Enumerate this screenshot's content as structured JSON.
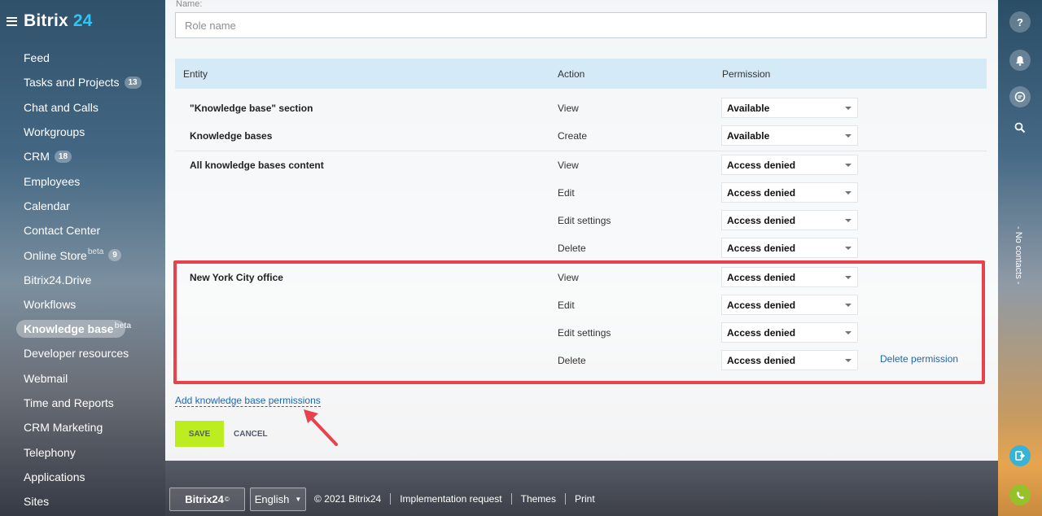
{
  "app": {
    "brand": "Bitrix",
    "brand_num": "24"
  },
  "sidebar": {
    "items": [
      {
        "label": "Feed"
      },
      {
        "label": "Tasks and Projects",
        "count": "13"
      },
      {
        "label": "Chat and Calls"
      },
      {
        "label": "Workgroups"
      },
      {
        "label": "CRM",
        "count": "18"
      },
      {
        "label": "Employees"
      },
      {
        "label": "Calendar"
      },
      {
        "label": "Contact Center"
      },
      {
        "label": "Online Store",
        "sup": "beta",
        "count": "9"
      },
      {
        "label": "Bitrix24.Drive"
      },
      {
        "label": "Workflows"
      },
      {
        "label": "Knowledge base",
        "sup": "beta",
        "active": true
      },
      {
        "label": "Developer resources"
      },
      {
        "label": "Webmail"
      },
      {
        "label": "Time and Reports"
      },
      {
        "label": "CRM Marketing"
      },
      {
        "label": "Telephony"
      },
      {
        "label": "Applications"
      },
      {
        "label": "Sites"
      }
    ]
  },
  "rightbar": {
    "no_contacts": "- No contacts -",
    "help_glyph": "?"
  },
  "form": {
    "name_label": "Name:",
    "name_placeholder": "Role name",
    "columns": {
      "entity": "Entity",
      "action": "Action",
      "permission": "Permission"
    },
    "rows": [
      {
        "entity": "\"Knowledge base\" section",
        "action": "View",
        "permission": "Available"
      },
      {
        "entity": "Knowledge bases",
        "action": "Create",
        "permission": "Available"
      },
      {
        "entity": "All knowledge bases content",
        "action": "View",
        "permission": "Access denied"
      },
      {
        "entity": "",
        "action": "Edit",
        "permission": "Access denied"
      },
      {
        "entity": "",
        "action": "Edit settings",
        "permission": "Access denied"
      },
      {
        "entity": "",
        "action": "Delete",
        "permission": "Access denied"
      },
      {
        "entity": "New York City office",
        "action": "View",
        "permission": "Access denied"
      },
      {
        "entity": "",
        "action": "Edit",
        "permission": "Access denied"
      },
      {
        "entity": "",
        "action": "Edit settings",
        "permission": "Access denied"
      },
      {
        "entity": "",
        "action": "Delete",
        "permission": "Access denied"
      }
    ],
    "delete_permission": "Delete permission",
    "add_permissions": "Add knowledge base permissions",
    "save": "SAVE",
    "cancel": "CANCEL"
  },
  "footer": {
    "logo": "Bitrix24",
    "logo_mark": "©",
    "language": "English",
    "copyright": "© 2021 Bitrix24",
    "links": [
      "Implementation request",
      "Themes",
      "Print"
    ]
  }
}
